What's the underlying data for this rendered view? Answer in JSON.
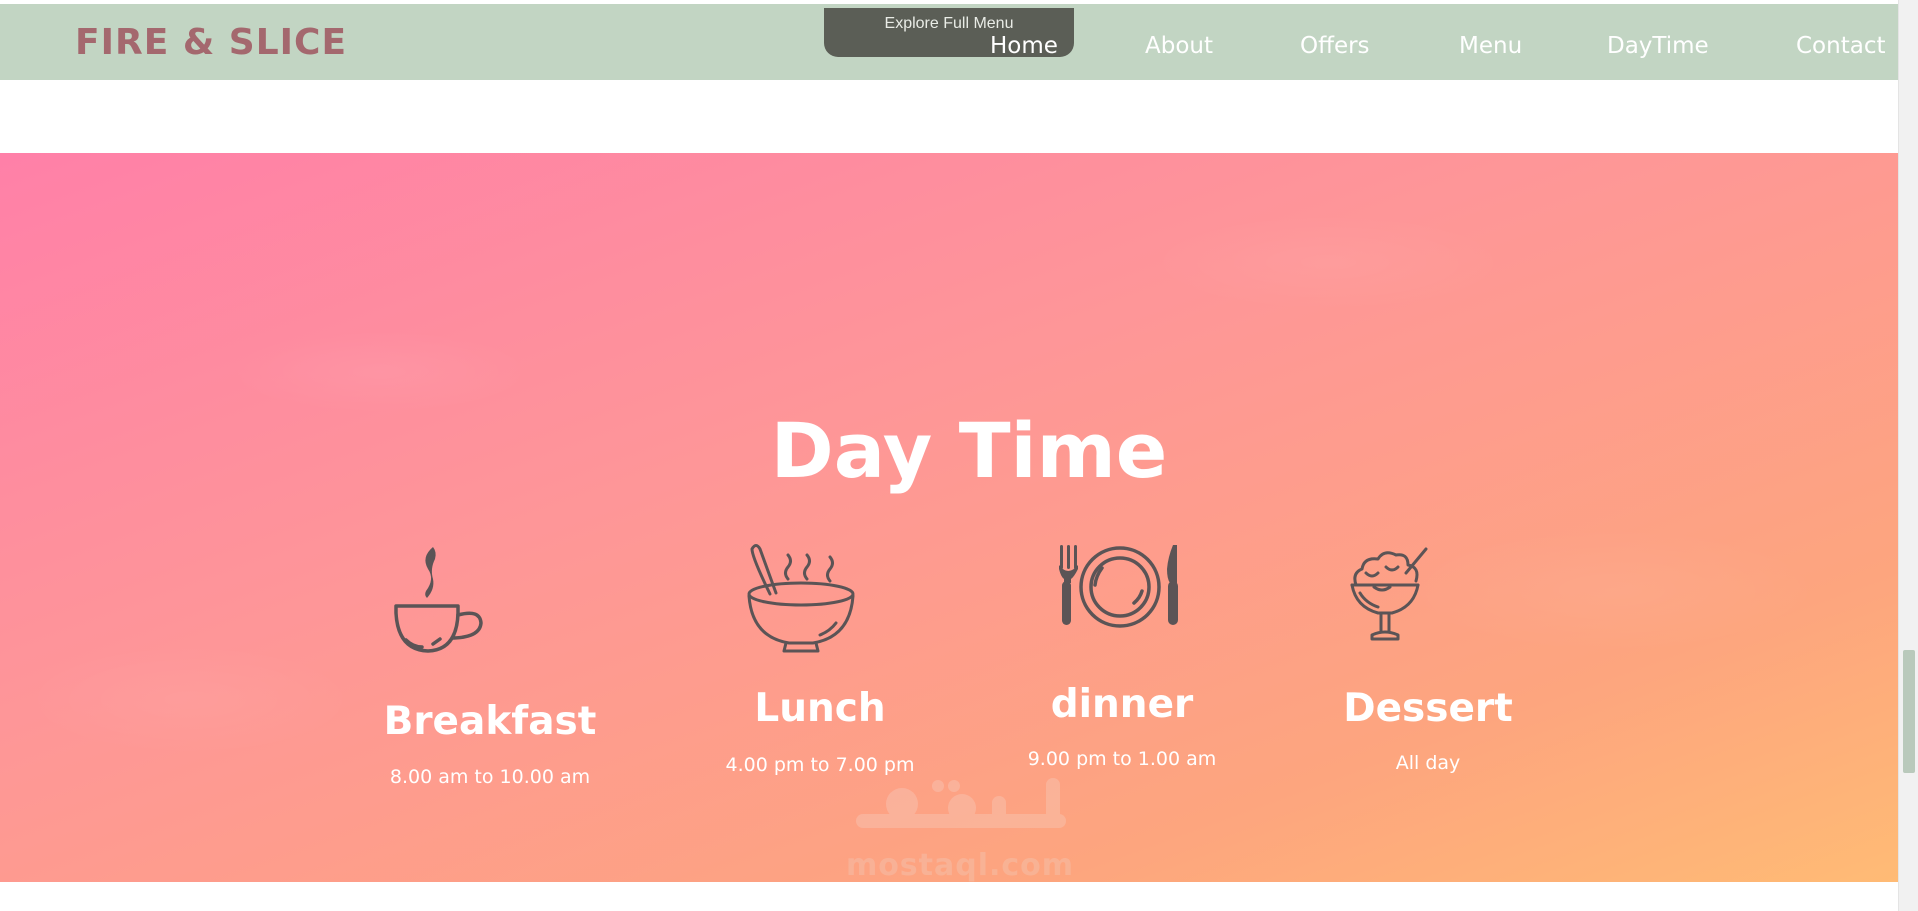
{
  "header": {
    "logo": "FIRE & SLICE",
    "explore_label": "Explore Full Menu",
    "nav": {
      "home": "Home",
      "about": "About",
      "offers": "Offers",
      "menu": "Menu",
      "daytime": "DayTime",
      "contact": "Contact"
    }
  },
  "daytime": {
    "title": "Day Time",
    "meals": [
      {
        "name": "Breakfast",
        "hours": "8.00 am to 10.00 am",
        "icon": "coffee-cup-icon"
      },
      {
        "name": "Lunch",
        "hours": "4.00 pm to 7.00 pm",
        "icon": "soup-bowl-icon"
      },
      {
        "name": "dinner",
        "hours": "9.00 pm to 1.00 am",
        "icon": "plate-fork-knife-icon"
      },
      {
        "name": "Dessert",
        "hours": "All day",
        "icon": "ice-cream-cup-icon"
      }
    ]
  },
  "watermark": {
    "text": "mostaql.com"
  },
  "colors": {
    "header_bg": "#c2d5c3",
    "logo": "#a4686e",
    "explore_tab": "#5b5e56",
    "gradient_start": "#ff80a8",
    "gradient_end": "#ffbb75",
    "icon_stroke": "#5b5456"
  }
}
